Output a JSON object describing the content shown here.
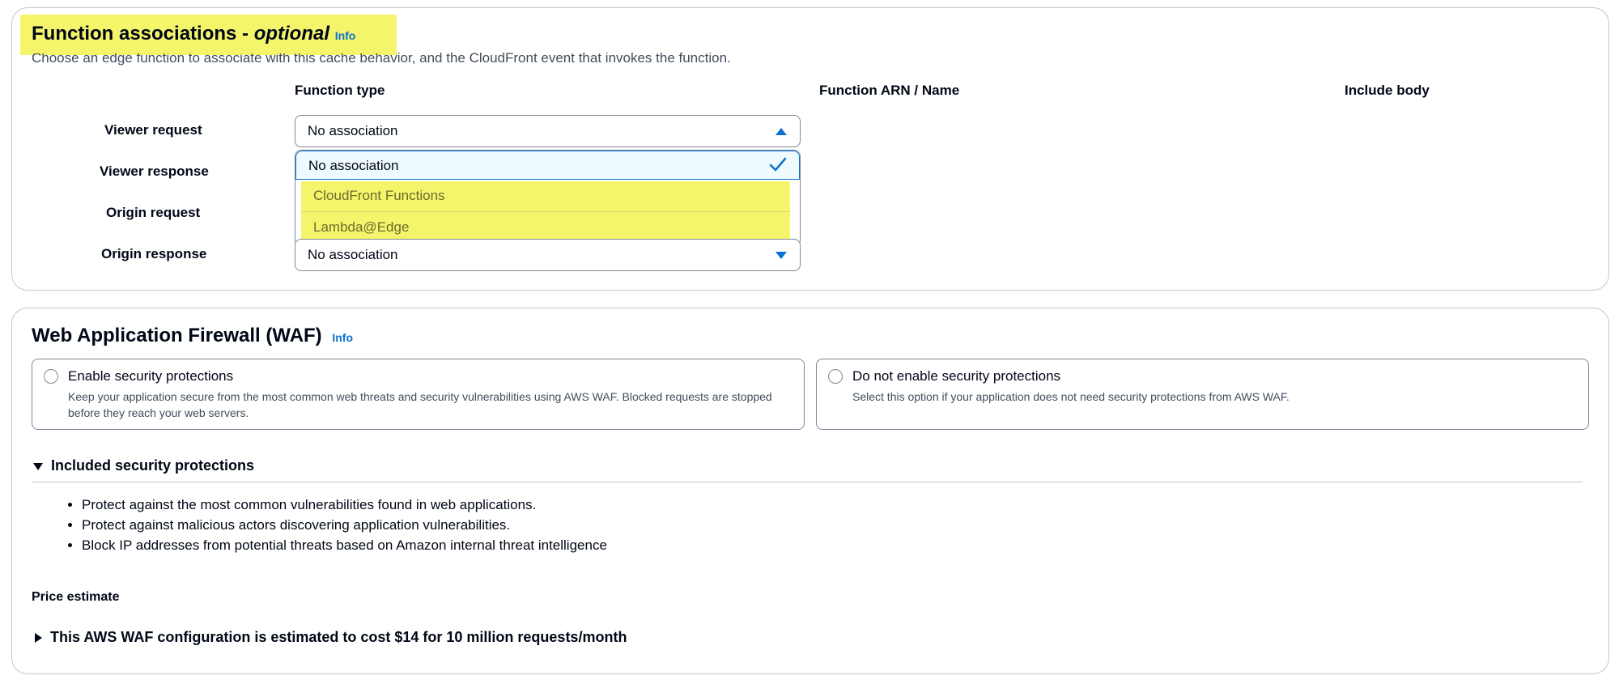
{
  "function_associations": {
    "title": "Function associations -",
    "title_optional": "optional",
    "info": "Info",
    "description": "Choose an edge function to associate with this cache behavior, and the CloudFront event that invokes the function.",
    "columns": {
      "function_type": "Function type",
      "function_arn": "Function ARN / Name",
      "include_body": "Include body"
    },
    "rows": [
      {
        "label": "Viewer request",
        "value": "No association"
      },
      {
        "label": "Viewer response"
      },
      {
        "label": "Origin request"
      },
      {
        "label": "Origin response",
        "value": "No association"
      }
    ],
    "dropdown_options": [
      {
        "label": "No association",
        "selected": true
      },
      {
        "label": "CloudFront Functions",
        "highlighted": true
      },
      {
        "label": "Lambda@Edge",
        "highlighted": true
      }
    ],
    "highlight_color": "#f5f56b"
  },
  "waf": {
    "title": "Web Application Firewall (WAF)",
    "info": "Info",
    "options": [
      {
        "title": "Enable security protections",
        "description": "Keep your application secure from the most common web threats and security vulnerabilities using AWS WAF. Blocked requests are stopped before they reach your web servers."
      },
      {
        "title": "Do not enable security protections",
        "description": "Select this option if your application does not need security protections from AWS WAF."
      }
    ],
    "included_heading": "Included security protections",
    "bullets": [
      "Protect against the most common vulnerabilities found in web applications.",
      "Protect against malicious actors discovering application vulnerabilities.",
      "Block IP addresses from potential threats based on Amazon internal threat intelligence"
    ],
    "price_label": "Price estimate",
    "price_expander": "This AWS WAF configuration is estimated to cost $14 for 10 million requests/month"
  },
  "colors": {
    "accent": "#0972d3",
    "border": "#7d8998",
    "text": "#000716"
  },
  "icons": [
    "caret-up-icon",
    "caret-down-icon",
    "checkmark-icon",
    "radio-icon",
    "expand-triangle-icon"
  ]
}
